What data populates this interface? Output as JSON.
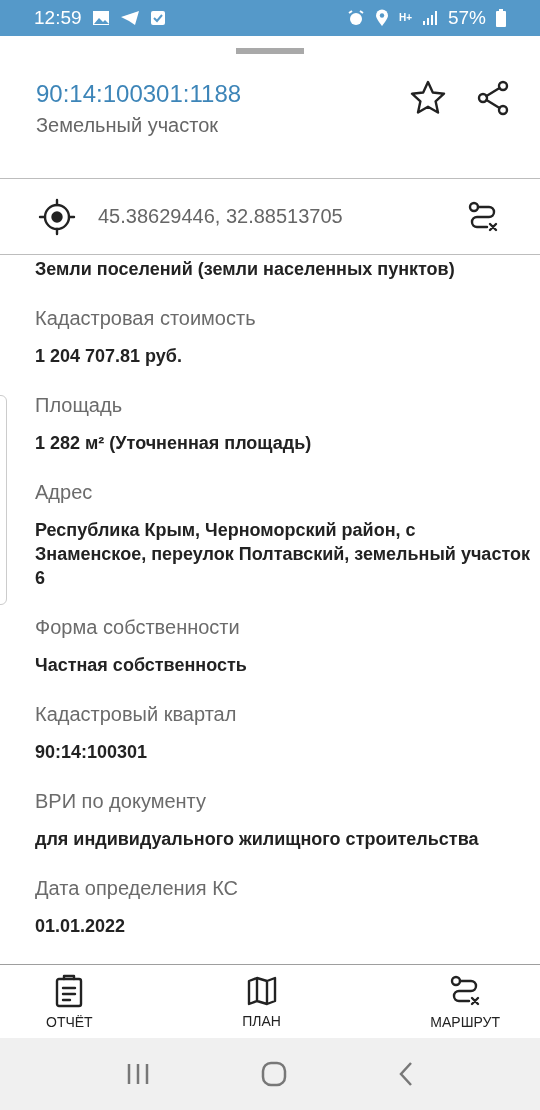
{
  "status_bar": {
    "time": "12:59",
    "network": "H+",
    "battery": "57%"
  },
  "header": {
    "title": "90:14:100301:1188",
    "subtitle": "Земельный участок"
  },
  "coordinates": "45.38629446, 32.88513705",
  "fields": [
    {
      "value": "Земли поселений (земли населенных пунктов)"
    },
    {
      "label": "Кадастровая стоимость",
      "value": "1 204 707.81 руб."
    },
    {
      "label": "Площадь",
      "value": "1 282 м² (Уточненная площадь)"
    },
    {
      "label": "Адрес",
      "value": "Республика Крым, Черноморский район, с Знаменское, переулок Полтавский, земельный участок 6"
    },
    {
      "label": "Форма собственности",
      "value": "Частная собственность"
    },
    {
      "label": "Кадастровый квартал",
      "value": "90:14:100301"
    },
    {
      "label": "ВРИ по документу",
      "value": "для индивидуального жилищного строительства"
    },
    {
      "label": "Дата определения КС",
      "value": "01.01.2022"
    }
  ],
  "bottom_nav": [
    {
      "kind": "report",
      "label": "ОТЧЁТ"
    },
    {
      "kind": "plan",
      "label": "ПЛАН"
    },
    {
      "kind": "route",
      "label": "МАРШРУТ"
    }
  ]
}
